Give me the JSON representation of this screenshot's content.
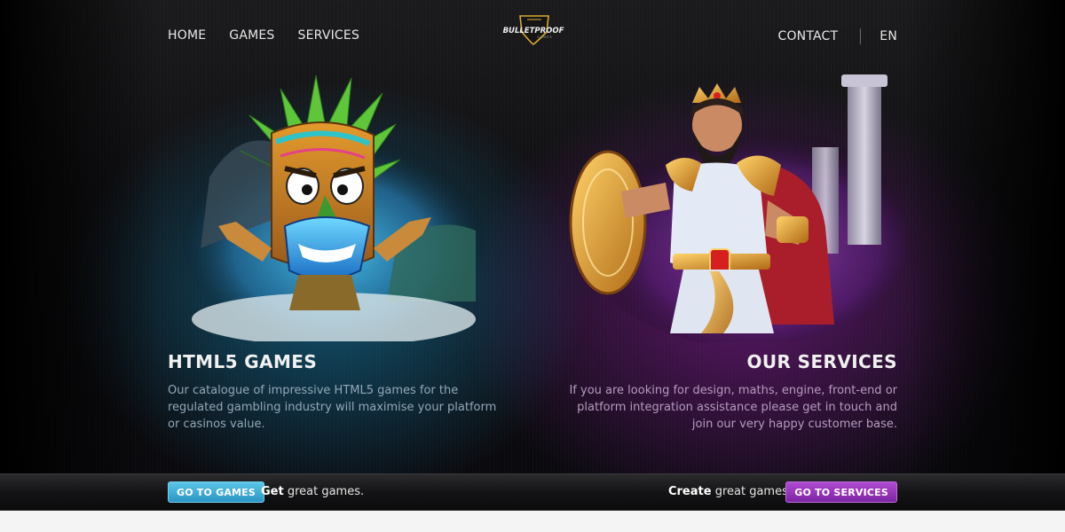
{
  "nav": {
    "left": [
      "HOME",
      "GAMES",
      "SERVICES"
    ],
    "contact": "CONTACT",
    "language": "EN"
  },
  "logo": {
    "text": "BULLETPROOF",
    "subtext": "GAMES"
  },
  "games": {
    "title": "HTML5 GAMES",
    "description": "Our catalogue of impressive HTML5 games for the regulated gambling industry will maximise your platform or casinos value.",
    "button": "GO TO GAMES",
    "tag_bold": "Get",
    "tag_rest": " great games."
  },
  "services": {
    "title": "OUR SERVICES",
    "description": "If you are looking for design, maths, engine, front-end or platform integration assistance please get in touch and join our very happy customer base.",
    "button": "GO TO SERVICES",
    "tag_bold": "Create",
    "tag_rest": " great games."
  },
  "colors": {
    "games_accent": "#2a95c4",
    "services_accent": "#7c25a3",
    "background": "#0a0a0e"
  },
  "icons": [
    "shield-logo-icon",
    "tiki-mask-illustration",
    "warrior-illustration"
  ]
}
